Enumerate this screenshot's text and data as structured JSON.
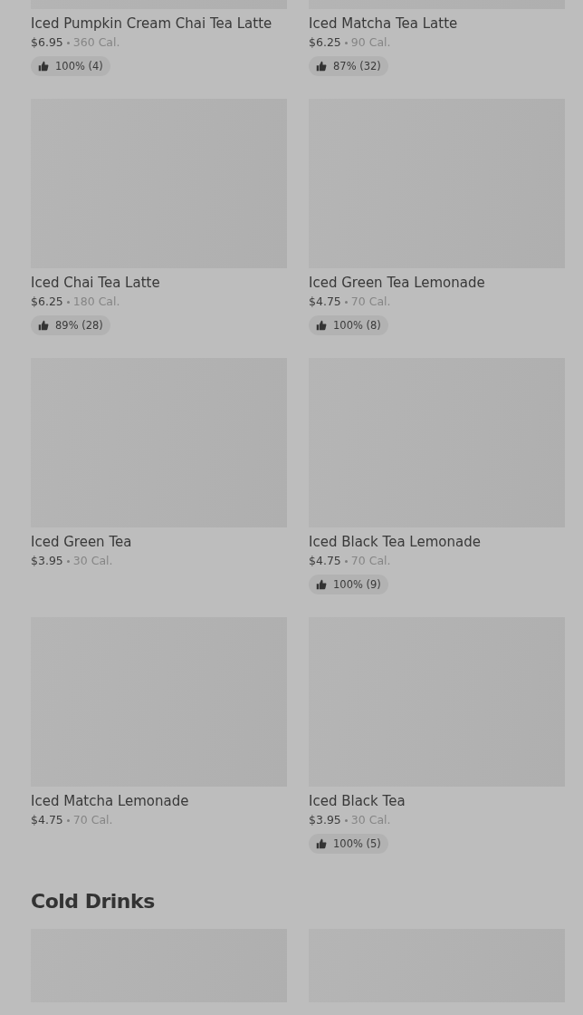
{
  "sections": [
    {
      "items": [
        {
          "name": "Iced Pumpkin Cream Chai Tea Latte",
          "price": "$6.95",
          "calories": "360 Cal.",
          "rating": "100% (4)"
        },
        {
          "name": "Iced Matcha Tea Latte",
          "price": "$6.25",
          "calories": "90 Cal.",
          "rating": "87% (32)"
        },
        {
          "name": "Iced Chai Tea Latte",
          "price": "$6.25",
          "calories": "180 Cal.",
          "rating": "89% (28)"
        },
        {
          "name": "Iced Green Tea Lemonade",
          "price": "$4.75",
          "calories": "70 Cal.",
          "rating": "100% (8)"
        },
        {
          "name": "Iced Green Tea",
          "price": "$3.95",
          "calories": "30 Cal."
        },
        {
          "name": "Iced Black Tea Lemonade",
          "price": "$4.75",
          "calories": "70 Cal.",
          "rating": "100% (9)"
        },
        {
          "name": "Iced Matcha Lemonade",
          "price": "$4.75",
          "calories": "70 Cal."
        },
        {
          "name": "Iced Black Tea",
          "price": "$3.95",
          "calories": "30 Cal.",
          "rating": "100% (5)"
        }
      ]
    },
    {
      "title": "Cold Drinks"
    }
  ]
}
